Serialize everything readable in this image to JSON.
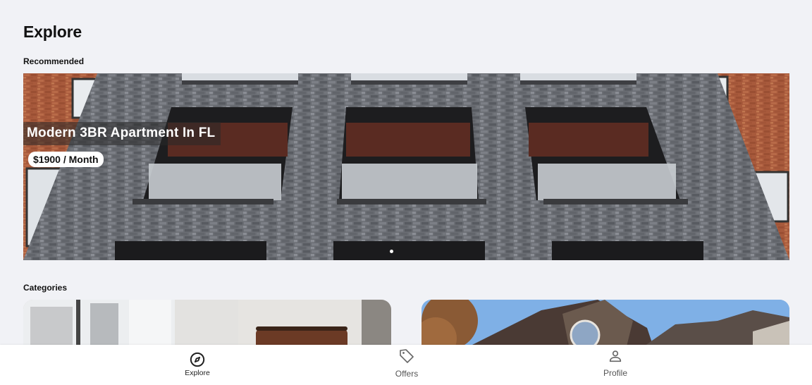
{
  "page": {
    "title": "Explore"
  },
  "recommended": {
    "section_title": "Recommended",
    "featured": {
      "title": "Modern 3BR Apartment In FL",
      "price": "$1900 / Month"
    },
    "carousel": {
      "slides": 2,
      "active_index": 1
    }
  },
  "categories": {
    "section_title": "Categories",
    "items": [
      {
        "image": "apartment-interior-photo"
      },
      {
        "image": "house-exterior-photo"
      }
    ]
  },
  "tabbar": {
    "items": [
      {
        "label": "Explore",
        "icon": "compass-icon",
        "active": true
      },
      {
        "label": "Offers",
        "icon": "tag-icon",
        "active": false
      },
      {
        "label": "Profile",
        "icon": "user-icon",
        "active": false
      }
    ]
  },
  "colors": {
    "background": "#f1f2f6",
    "tabbar": "#ffffff",
    "text": "#111111"
  }
}
